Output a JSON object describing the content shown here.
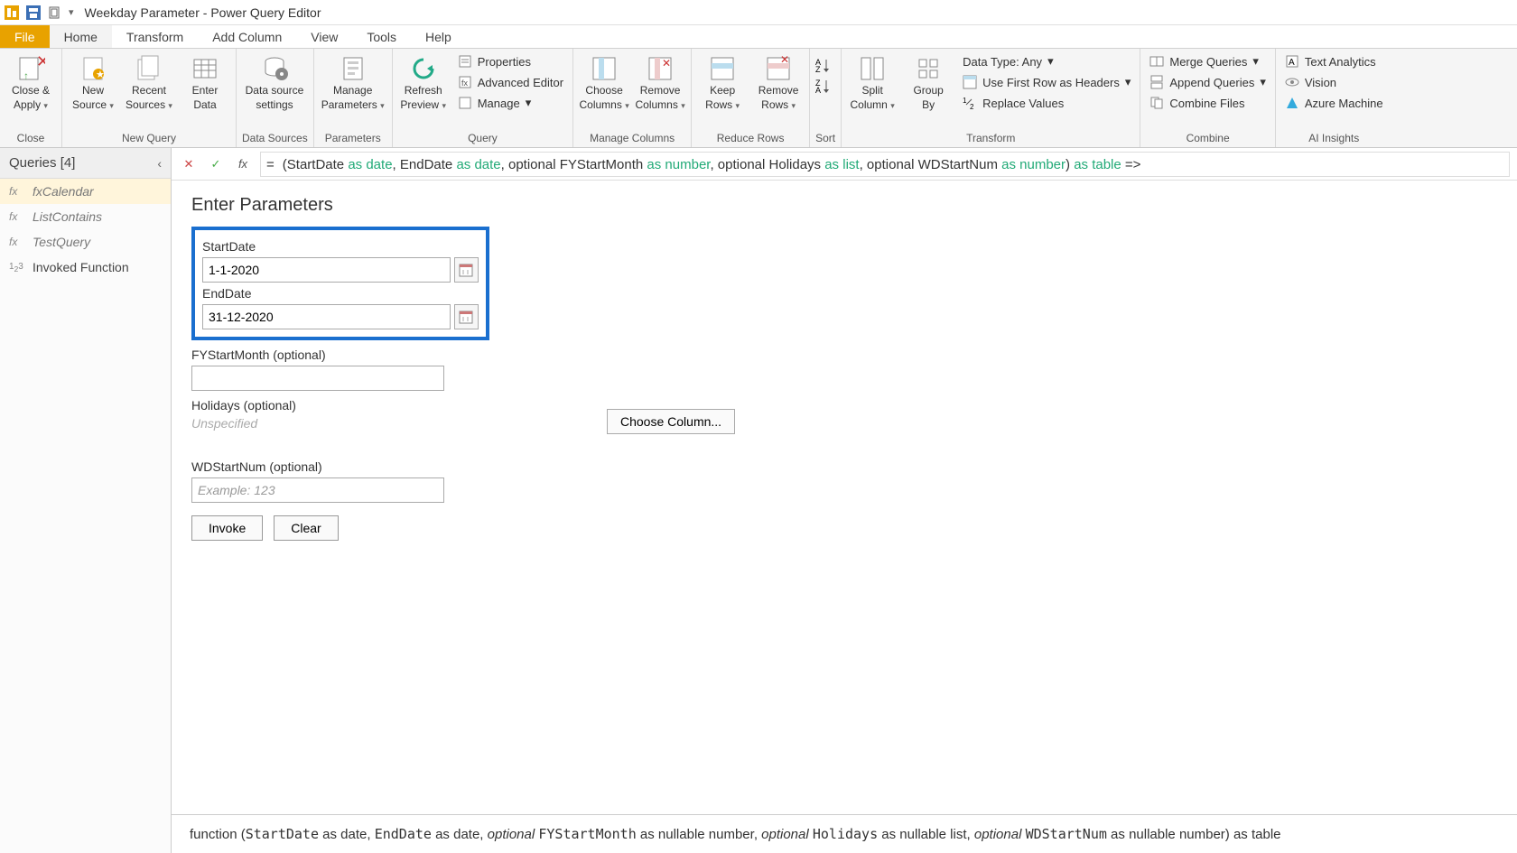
{
  "titlebar": {
    "title": "Weekday Parameter - Power Query Editor"
  },
  "menu": {
    "file": "File",
    "home": "Home",
    "transform": "Transform",
    "addcol": "Add Column",
    "view": "View",
    "tools": "Tools",
    "help": "Help"
  },
  "ribbon": {
    "close_apply": "Close &",
    "close_apply2": "Apply",
    "close_group": "Close",
    "new_source": "New",
    "new_source2": "Source",
    "recent_sources": "Recent",
    "recent_sources2": "Sources",
    "enter_data": "Enter",
    "enter_data2": "Data",
    "newquery_group": "New Query",
    "data_source": "Data source",
    "data_source2": "settings",
    "ds_group": "Data Sources",
    "manage_params": "Manage",
    "manage_params2": "Parameters",
    "params_group": "Parameters",
    "refresh": "Refresh",
    "refresh2": "Preview",
    "properties": "Properties",
    "adv_editor": "Advanced Editor",
    "manage": "Manage",
    "query_group": "Query",
    "choose_cols": "Choose",
    "choose_cols2": "Columns",
    "remove_cols": "Remove",
    "remove_cols2": "Columns",
    "mc_group": "Manage Columns",
    "keep_rows": "Keep",
    "keep_rows2": "Rows",
    "remove_rows": "Remove",
    "remove_rows2": "Rows",
    "rr_group": "Reduce Rows",
    "sort_group": "Sort",
    "split_col": "Split",
    "split_col2": "Column",
    "group_by": "Group",
    "group_by2": "By",
    "dtype": "Data Type: Any",
    "first_row": "Use First Row as Headers",
    "replace": "Replace Values",
    "tr_group": "Transform",
    "merge": "Merge Queries",
    "append": "Append Queries",
    "combine_files": "Combine Files",
    "combine_group": "Combine",
    "text_an": "Text Analytics",
    "vision": "Vision",
    "azure_ml": "Azure Machine",
    "ai_group": "AI Insights"
  },
  "queries": {
    "header": "Queries [4]",
    "items": [
      {
        "label": "fxCalendar",
        "icon": "fx",
        "sel": true,
        "ital": true
      },
      {
        "label": "ListContains",
        "icon": "fx",
        "sel": false,
        "ital": true
      },
      {
        "label": "TestQuery",
        "icon": "fx",
        "sel": false,
        "ital": true
      },
      {
        "label": "Invoked Function",
        "icon": "123",
        "sel": false,
        "ital": false
      }
    ]
  },
  "formula": {
    "eq": "=",
    "p_open": "(StartDate ",
    "as1": "as ",
    "t1": "date",
    "c1": ", EndDate ",
    "as2": "as ",
    "t2": "date",
    "c2": ", optional FYStartMonth ",
    "as3": "as ",
    "t3": "number",
    "c3": ", optional Holidays ",
    "as4": "as ",
    "t4": "list",
    "c4": ", optional WDStartNum ",
    "as5": "as ",
    "t5": "number",
    "p_close": ") ",
    "as6": "as ",
    "t6": "table",
    "arrow": " =>"
  },
  "params": {
    "heading": "Enter Parameters",
    "start_label": "StartDate",
    "start_value": "1-1-2020",
    "end_label": "EndDate",
    "end_value": "31-12-2020",
    "fy_label": "FYStartMonth (optional)",
    "fy_value": "",
    "hol_label": "Holidays (optional)",
    "hol_unspec": "Unspecified",
    "choose_col": "Choose Column...",
    "wd_label": "WDStartNum (optional)",
    "wd_placeholder": "Example: 123",
    "invoke": "Invoke",
    "clear": "Clear"
  },
  "signature": {
    "pre": "function (",
    "sd": "StartDate",
    "sd_t": " as date, ",
    "ed": "EndDate",
    "ed_t": " as date, ",
    "opt1": "optional ",
    "fy": "FYStartMonth",
    "fy_t": " as nullable number, ",
    "opt2": "optional ",
    "hol": "Holidays",
    "hol_t": " as nullable list, ",
    "opt3": "optional ",
    "wd": "WDStartNum",
    "wd_t": " as nullable number) as table"
  }
}
